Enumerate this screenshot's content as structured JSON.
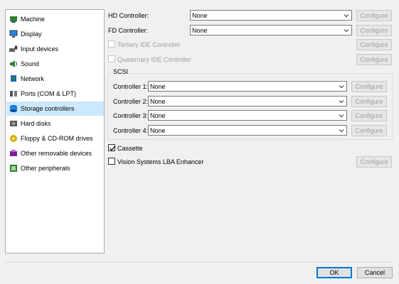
{
  "sidebar": {
    "items": [
      {
        "label": "Machine",
        "icon": "machine-icon"
      },
      {
        "label": "Display",
        "icon": "display-icon"
      },
      {
        "label": "Input devices",
        "icon": "input-devices-icon"
      },
      {
        "label": "Sound",
        "icon": "sound-icon"
      },
      {
        "label": "Network",
        "icon": "network-icon"
      },
      {
        "label": "Ports (COM & LPT)",
        "icon": "ports-icon"
      },
      {
        "label": "Storage controllers",
        "icon": "storage-controllers-icon",
        "selected": true
      },
      {
        "label": "Hard disks",
        "icon": "hard-disks-icon"
      },
      {
        "label": "Floppy & CD-ROM drives",
        "icon": "floppy-cdrom-icon"
      },
      {
        "label": "Other removable devices",
        "icon": "removable-devices-icon"
      },
      {
        "label": "Other peripherals",
        "icon": "peripherals-icon"
      }
    ]
  },
  "hd": {
    "label": "HD Controller:",
    "value": "None",
    "configure": "Configure"
  },
  "fd": {
    "label": "FD Controller:",
    "value": "None",
    "configure": "Configure"
  },
  "tertiary": {
    "label": "Tertiary IDE Controller",
    "configure": "Configure",
    "checked": false
  },
  "quaternary": {
    "label": "Quaternary IDE Controller",
    "configure": "Configure",
    "checked": false
  },
  "scsi": {
    "title": "SCSI",
    "controllers": [
      {
        "label": "Controller 1:",
        "value": "None",
        "configure": "Configure"
      },
      {
        "label": "Controller 2:",
        "value": "None",
        "configure": "Configure"
      },
      {
        "label": "Controller 3:",
        "value": "None",
        "configure": "Configure"
      },
      {
        "label": "Controller 4:",
        "value": "None",
        "configure": "Configure"
      }
    ]
  },
  "cassette": {
    "label": "Cassette",
    "checked": true
  },
  "vision": {
    "label": "Vision Systems LBA Enhancer",
    "checked": false,
    "configure": "Configure"
  },
  "footer": {
    "ok": "OK",
    "cancel": "Cancel"
  },
  "colors": {
    "selection": "#cce8ff",
    "accent": "#0078d7"
  }
}
